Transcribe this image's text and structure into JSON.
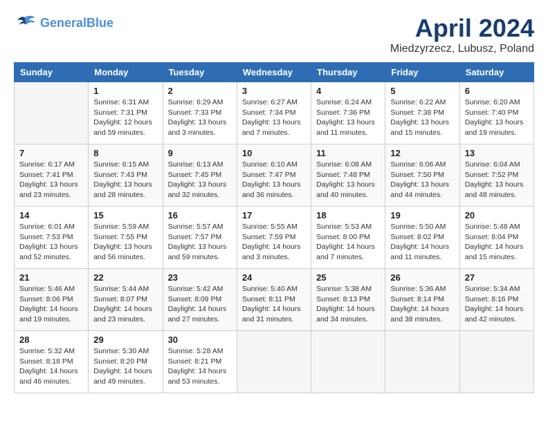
{
  "header": {
    "logo_line1": "General",
    "logo_line2": "Blue",
    "month": "April 2024",
    "location": "Miedzyrzecz, Lubusz, Poland"
  },
  "columns": [
    "Sunday",
    "Monday",
    "Tuesday",
    "Wednesday",
    "Thursday",
    "Friday",
    "Saturday"
  ],
  "weeks": [
    [
      {
        "day": "",
        "info": ""
      },
      {
        "day": "1",
        "info": "Sunrise: 6:31 AM\nSunset: 7:31 PM\nDaylight: 12 hours\nand 59 minutes."
      },
      {
        "day": "2",
        "info": "Sunrise: 6:29 AM\nSunset: 7:33 PM\nDaylight: 13 hours\nand 3 minutes."
      },
      {
        "day": "3",
        "info": "Sunrise: 6:27 AM\nSunset: 7:34 PM\nDaylight: 13 hours\nand 7 minutes."
      },
      {
        "day": "4",
        "info": "Sunrise: 6:24 AM\nSunset: 7:36 PM\nDaylight: 13 hours\nand 11 minutes."
      },
      {
        "day": "5",
        "info": "Sunrise: 6:22 AM\nSunset: 7:38 PM\nDaylight: 13 hours\nand 15 minutes."
      },
      {
        "day": "6",
        "info": "Sunrise: 6:20 AM\nSunset: 7:40 PM\nDaylight: 13 hours\nand 19 minutes."
      }
    ],
    [
      {
        "day": "7",
        "info": "Sunrise: 6:17 AM\nSunset: 7:41 PM\nDaylight: 13 hours\nand 23 minutes."
      },
      {
        "day": "8",
        "info": "Sunrise: 6:15 AM\nSunset: 7:43 PM\nDaylight: 13 hours\nand 28 minutes."
      },
      {
        "day": "9",
        "info": "Sunrise: 6:13 AM\nSunset: 7:45 PM\nDaylight: 13 hours\nand 32 minutes."
      },
      {
        "day": "10",
        "info": "Sunrise: 6:10 AM\nSunset: 7:47 PM\nDaylight: 13 hours\nand 36 minutes."
      },
      {
        "day": "11",
        "info": "Sunrise: 6:08 AM\nSunset: 7:48 PM\nDaylight: 13 hours\nand 40 minutes."
      },
      {
        "day": "12",
        "info": "Sunrise: 6:06 AM\nSunset: 7:50 PM\nDaylight: 13 hours\nand 44 minutes."
      },
      {
        "day": "13",
        "info": "Sunrise: 6:04 AM\nSunset: 7:52 PM\nDaylight: 13 hours\nand 48 minutes."
      }
    ],
    [
      {
        "day": "14",
        "info": "Sunrise: 6:01 AM\nSunset: 7:53 PM\nDaylight: 13 hours\nand 52 minutes."
      },
      {
        "day": "15",
        "info": "Sunrise: 5:59 AM\nSunset: 7:55 PM\nDaylight: 13 hours\nand 56 minutes."
      },
      {
        "day": "16",
        "info": "Sunrise: 5:57 AM\nSunset: 7:57 PM\nDaylight: 13 hours\nand 59 minutes."
      },
      {
        "day": "17",
        "info": "Sunrise: 5:55 AM\nSunset: 7:59 PM\nDaylight: 14 hours\nand 3 minutes."
      },
      {
        "day": "18",
        "info": "Sunrise: 5:53 AM\nSunset: 8:00 PM\nDaylight: 14 hours\nand 7 minutes."
      },
      {
        "day": "19",
        "info": "Sunrise: 5:50 AM\nSunset: 8:02 PM\nDaylight: 14 hours\nand 11 minutes."
      },
      {
        "day": "20",
        "info": "Sunrise: 5:48 AM\nSunset: 8:04 PM\nDaylight: 14 hours\nand 15 minutes."
      }
    ],
    [
      {
        "day": "21",
        "info": "Sunrise: 5:46 AM\nSunset: 8:06 PM\nDaylight: 14 hours\nand 19 minutes."
      },
      {
        "day": "22",
        "info": "Sunrise: 5:44 AM\nSunset: 8:07 PM\nDaylight: 14 hours\nand 23 minutes."
      },
      {
        "day": "23",
        "info": "Sunrise: 5:42 AM\nSunset: 8:09 PM\nDaylight: 14 hours\nand 27 minutes."
      },
      {
        "day": "24",
        "info": "Sunrise: 5:40 AM\nSunset: 8:11 PM\nDaylight: 14 hours\nand 31 minutes."
      },
      {
        "day": "25",
        "info": "Sunrise: 5:38 AM\nSunset: 8:13 PM\nDaylight: 14 hours\nand 34 minutes."
      },
      {
        "day": "26",
        "info": "Sunrise: 5:36 AM\nSunset: 8:14 PM\nDaylight: 14 hours\nand 38 minutes."
      },
      {
        "day": "27",
        "info": "Sunrise: 5:34 AM\nSunset: 8:16 PM\nDaylight: 14 hours\nand 42 minutes."
      }
    ],
    [
      {
        "day": "28",
        "info": "Sunrise: 5:32 AM\nSunset: 8:18 PM\nDaylight: 14 hours\nand 46 minutes."
      },
      {
        "day": "29",
        "info": "Sunrise: 5:30 AM\nSunset: 8:20 PM\nDaylight: 14 hours\nand 49 minutes."
      },
      {
        "day": "30",
        "info": "Sunrise: 5:28 AM\nSunset: 8:21 PM\nDaylight: 14 hours\nand 53 minutes."
      },
      {
        "day": "",
        "info": ""
      },
      {
        "day": "",
        "info": ""
      },
      {
        "day": "",
        "info": ""
      },
      {
        "day": "",
        "info": ""
      }
    ]
  ]
}
